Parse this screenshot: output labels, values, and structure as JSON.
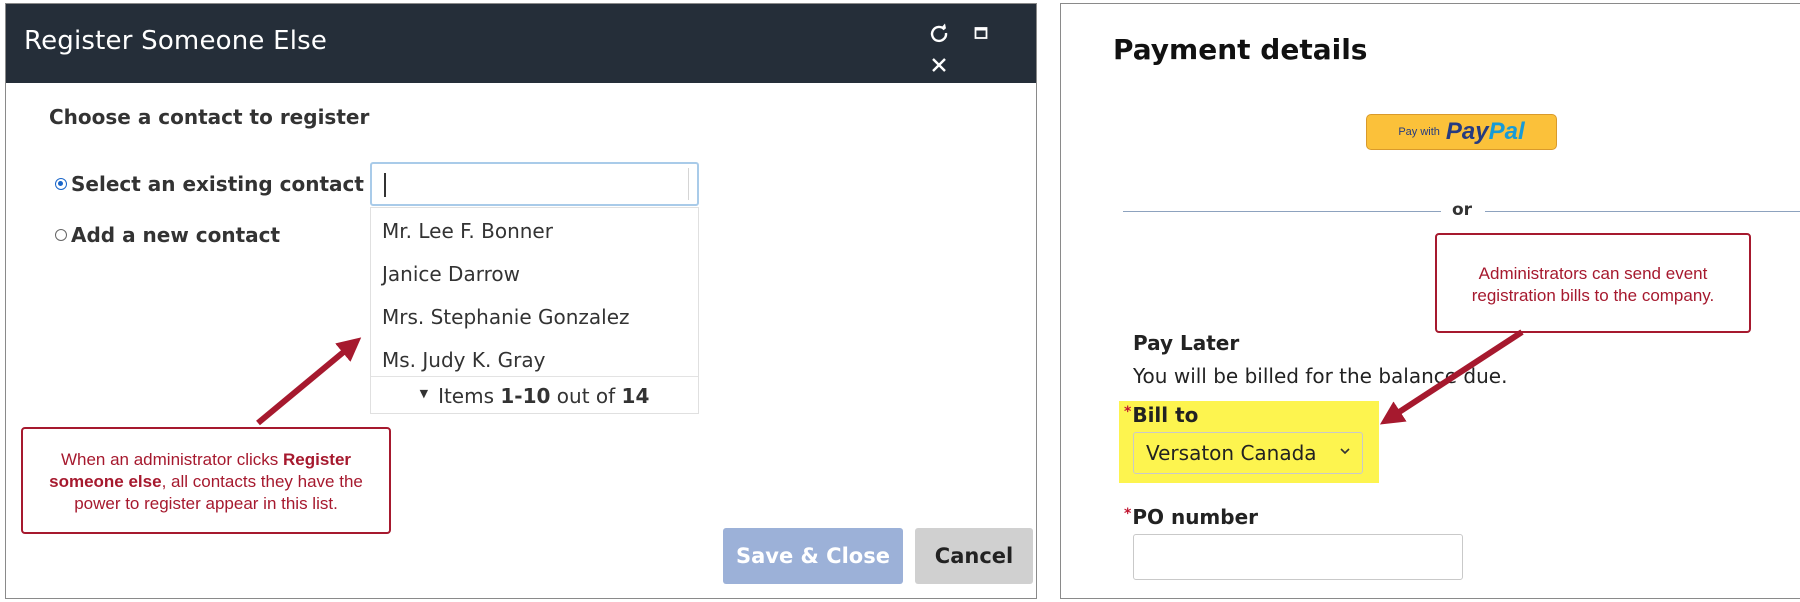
{
  "dialog": {
    "title": "Register Someone Else",
    "section_label": "Choose a contact to register",
    "radio_existing": "Select an existing contact",
    "radio_new": "Add a new contact",
    "search": {
      "value": "",
      "placeholder": ""
    },
    "contacts": [
      "Mr. Lee F. Bonner",
      "Janice Darrow",
      "Mrs. Stephanie Gonzalez",
      "Ms. Judy K. Gray"
    ],
    "pager": {
      "prefix": "Items",
      "range": "1-10",
      "middle": "out of",
      "total": "14"
    },
    "save_label": "Save & Close",
    "cancel_label": "Cancel",
    "callout": {
      "part1": "When an administrator clicks",
      "bold": "Register someone else",
      "part2": ", all contacts they have the power to register appear in this list."
    }
  },
  "payment": {
    "title": "Payment details",
    "paypal": {
      "prefix": "Pay with",
      "pay": "Pay",
      "pal": "Pal"
    },
    "or_label": "or",
    "callout": "Administrators can send event registration bills to the company.",
    "pay_later_label": "Pay Later",
    "pay_later_desc": "You will be billed for the balance due.",
    "bill_to_label": "Bill to",
    "bill_to_value": "Versaton Canada",
    "po_label": "PO number",
    "po_value": ""
  },
  "colors": {
    "titlebar": "#252e39",
    "callout": "#a6192e",
    "highlight": "#fdf44f",
    "save_button": "#9cb1d8",
    "paypal": "#fbc13a"
  }
}
